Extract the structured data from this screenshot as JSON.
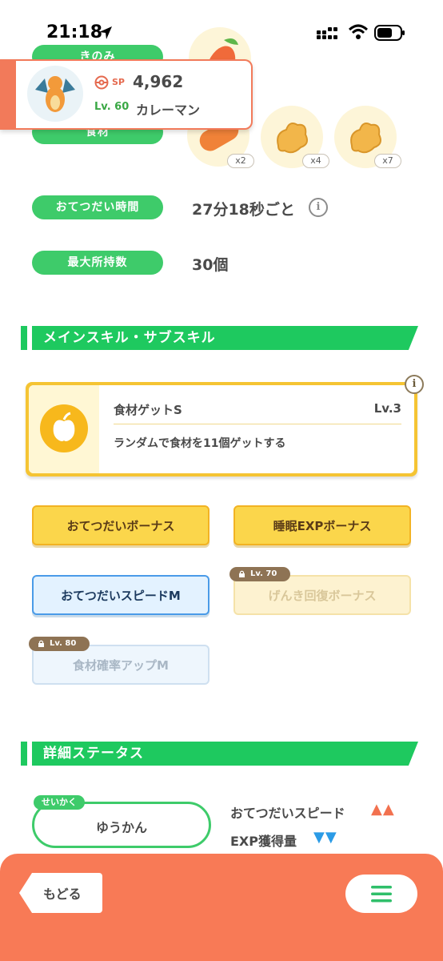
{
  "status_bar": {
    "time": "21:18"
  },
  "info_rows": {
    "berry_label": "きのみ",
    "ingredient_label": "食材",
    "ingredient_counts": [
      "x2",
      "x4",
      "x7"
    ],
    "help_time_label": "おてつだい時間",
    "help_time_value": "27分18秒ごと",
    "max_carry_label": "最大所持数",
    "max_carry_value": "30個"
  },
  "pokemon_card": {
    "sp_label": "SP",
    "sp_value": "4,962",
    "level": "Lv. 60",
    "name": "カレーマン"
  },
  "main_skill_section": {
    "title": "メインスキル・サブスキル",
    "skill_name": "食材ゲットS",
    "skill_level": "Lv.3",
    "skill_description": "ランダムで食材を11個ゲットする"
  },
  "sub_skills": [
    {
      "label": "おてつだいボーナス",
      "locked": false
    },
    {
      "label": "睡眠EXPボーナス",
      "locked": false
    },
    {
      "label": "おてつだいスピードM",
      "locked": false
    },
    {
      "label": "げんき回復ボーナス",
      "locked": true,
      "lock_level": "Lv. 70"
    },
    {
      "label": "食材確率アップM",
      "locked": true,
      "lock_level": "Lv. 80"
    }
  ],
  "detail_section": {
    "title": "詳細ステータス",
    "nature_tag": "せいかく",
    "nature_value": "ゆうかん",
    "stat_up_label": "おてつだいスピード",
    "stat_up_arrows": "▲▲",
    "stat_down_label": "EXP獲得量",
    "stat_down_arrows": "▼▼",
    "up_color": "#f2714f",
    "down_color": "#2b9be6"
  },
  "footer": {
    "back_label": "もどる"
  },
  "colors": {
    "accent_green": "#1ec95f",
    "footer": "#f87a56",
    "gold": "#fbd64b"
  }
}
